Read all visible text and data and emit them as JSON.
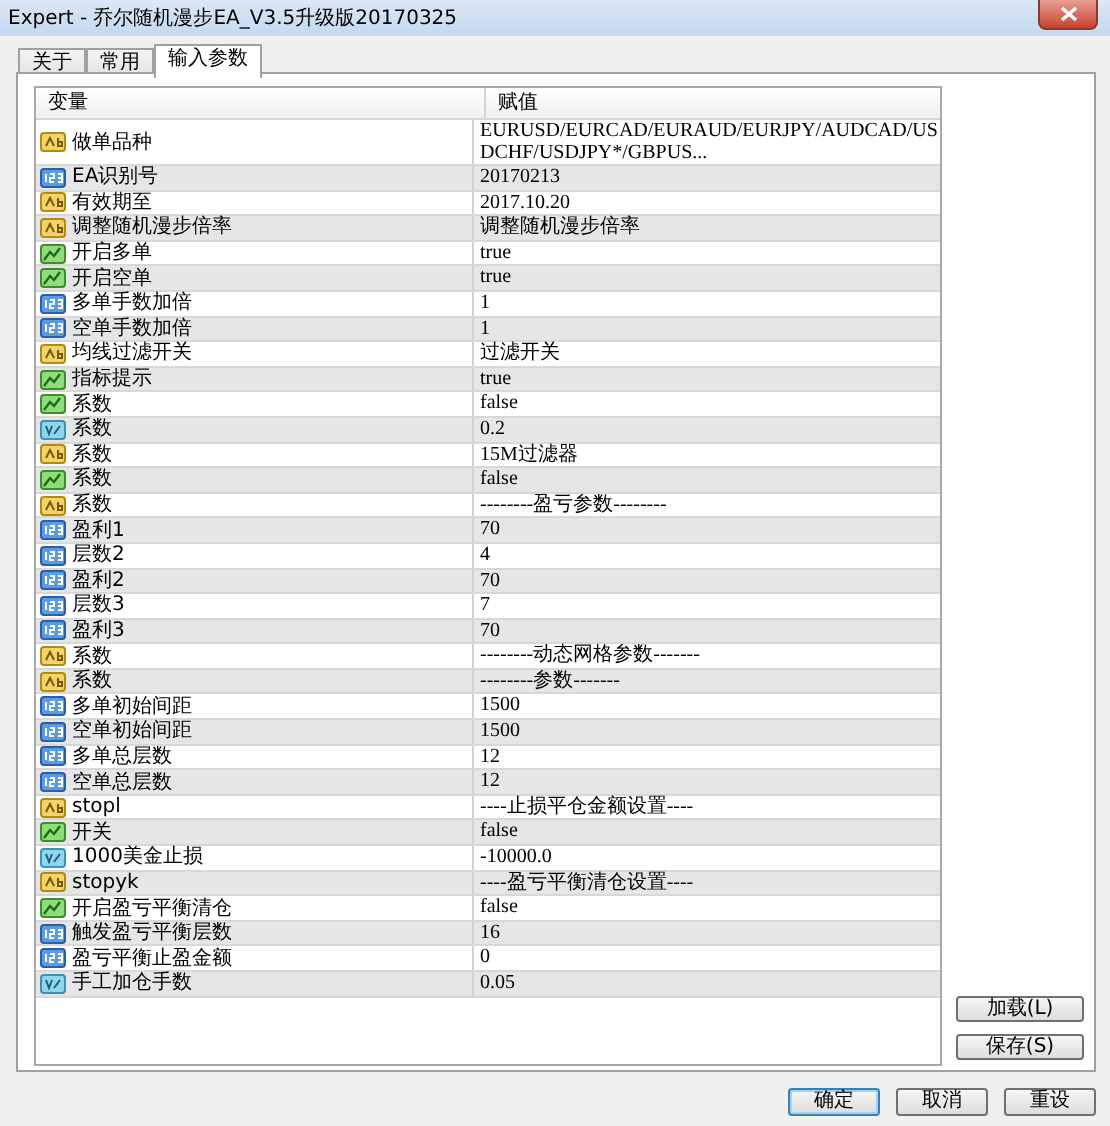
{
  "window": {
    "title": "Expert - 乔尔随机漫步EA_V3.5升级版20170325"
  },
  "tabs": [
    {
      "label": "关于",
      "selected": false
    },
    {
      "label": "常用",
      "selected": false
    },
    {
      "label": "输入参数",
      "selected": true
    }
  ],
  "table": {
    "columns": [
      "变量",
      "赋值"
    ],
    "rows": [
      {
        "kind": "string",
        "name": "做单品种",
        "value": "EURUSD/EURCAD/EURAUD/EURJPY/AUDCAD/USDCHF/USDJPY*/GBPUS..."
      },
      {
        "kind": "int",
        "name": "EA识别号",
        "value": "20170213"
      },
      {
        "kind": "string",
        "name": "有效期至",
        "value": "2017.10.20"
      },
      {
        "kind": "string",
        "name": "调整随机漫步倍率",
        "value": "调整随机漫步倍率"
      },
      {
        "kind": "bool",
        "name": "开启多单",
        "value": "true"
      },
      {
        "kind": "bool",
        "name": "开启空单",
        "value": "true"
      },
      {
        "kind": "int",
        "name": "多单手数加倍",
        "value": "1"
      },
      {
        "kind": "int",
        "name": "空单手数加倍",
        "value": "1"
      },
      {
        "kind": "string",
        "name": "均线过滤开关",
        "value": "过滤开关"
      },
      {
        "kind": "bool",
        "name": "指标提示",
        "value": "true"
      },
      {
        "kind": "bool",
        "name": "系数",
        "value": "false"
      },
      {
        "kind": "double",
        "name": "系数",
        "value": "0.2"
      },
      {
        "kind": "string",
        "name": "系数",
        "value": "15M过滤器"
      },
      {
        "kind": "bool",
        "name": "系数",
        "value": "false"
      },
      {
        "kind": "string",
        "name": "系数",
        "value": "--------盈亏参数--------"
      },
      {
        "kind": "int",
        "name": "盈利1",
        "value": "70"
      },
      {
        "kind": "int",
        "name": "层数2",
        "value": "4"
      },
      {
        "kind": "int",
        "name": "盈利2",
        "value": "70"
      },
      {
        "kind": "int",
        "name": "层数3",
        "value": "7"
      },
      {
        "kind": "int",
        "name": "盈利3",
        "value": "70"
      },
      {
        "kind": "string",
        "name": "系数",
        "value": "--------动态网格参数-------"
      },
      {
        "kind": "string",
        "name": "系数",
        "value": "--------参数-------"
      },
      {
        "kind": "int",
        "name": "多单初始间距",
        "value": "1500"
      },
      {
        "kind": "int",
        "name": "空单初始间距",
        "value": "1500"
      },
      {
        "kind": "int",
        "name": "多单总层数",
        "value": "12"
      },
      {
        "kind": "int",
        "name": "空单总层数",
        "value": "12"
      },
      {
        "kind": "string",
        "name": "stopl",
        "value": "----止损平仓金额设置----"
      },
      {
        "kind": "bool",
        "name": "开关",
        "value": "false"
      },
      {
        "kind": "double",
        "name": "1000美金止损",
        "value": "-10000.0"
      },
      {
        "kind": "string",
        "name": "stopyk",
        "value": "----盈亏平衡清仓设置----"
      },
      {
        "kind": "bool",
        "name": "开启盈亏平衡清仓",
        "value": "false"
      },
      {
        "kind": "int",
        "name": "触发盈亏平衡层数",
        "value": "16"
      },
      {
        "kind": "int",
        "name": "盈亏平衡止盈金额",
        "value": "0"
      },
      {
        "kind": "double",
        "name": "手工加仓手数",
        "value": "0.05"
      }
    ]
  },
  "side_buttons": [
    "加载(L)",
    "保存(S)"
  ],
  "buttons": [
    {
      "label": "确定",
      "default": true
    },
    {
      "label": "取消",
      "default": false
    },
    {
      "label": "重设",
      "default": false
    }
  ]
}
